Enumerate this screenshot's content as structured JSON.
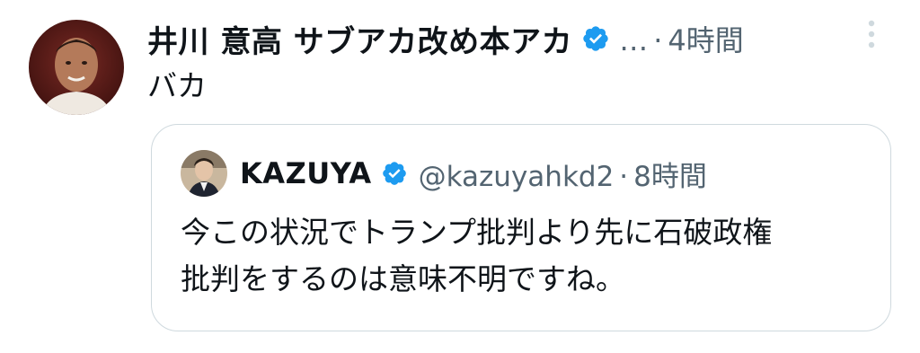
{
  "colors": {
    "text_primary": "#0f1419",
    "text_secondary": "#536471",
    "verified_blue": "#1d9bf0",
    "border": "#cfd9de"
  },
  "tweet": {
    "avatar_icon": "user-avatar-photo",
    "display_name": "井川 意高 サブアカ改め本アカ",
    "verified_icon": "verified-badge-icon",
    "handle_ellipsis": "…",
    "separator": "·",
    "time": "4時間",
    "more_icon": "more-vertical-icon",
    "text": "バカ"
  },
  "quote": {
    "avatar_icon": "user-avatar-photo",
    "display_name": "KAZUYA",
    "verified_icon": "verified-badge-icon",
    "handle": "@kazuyahkd2",
    "separator": "·",
    "time": "8時間",
    "text_lines": [
      "今この状況でトランプ批判より先に石破政権",
      "批判をするのは意味不明ですね。"
    ]
  }
}
